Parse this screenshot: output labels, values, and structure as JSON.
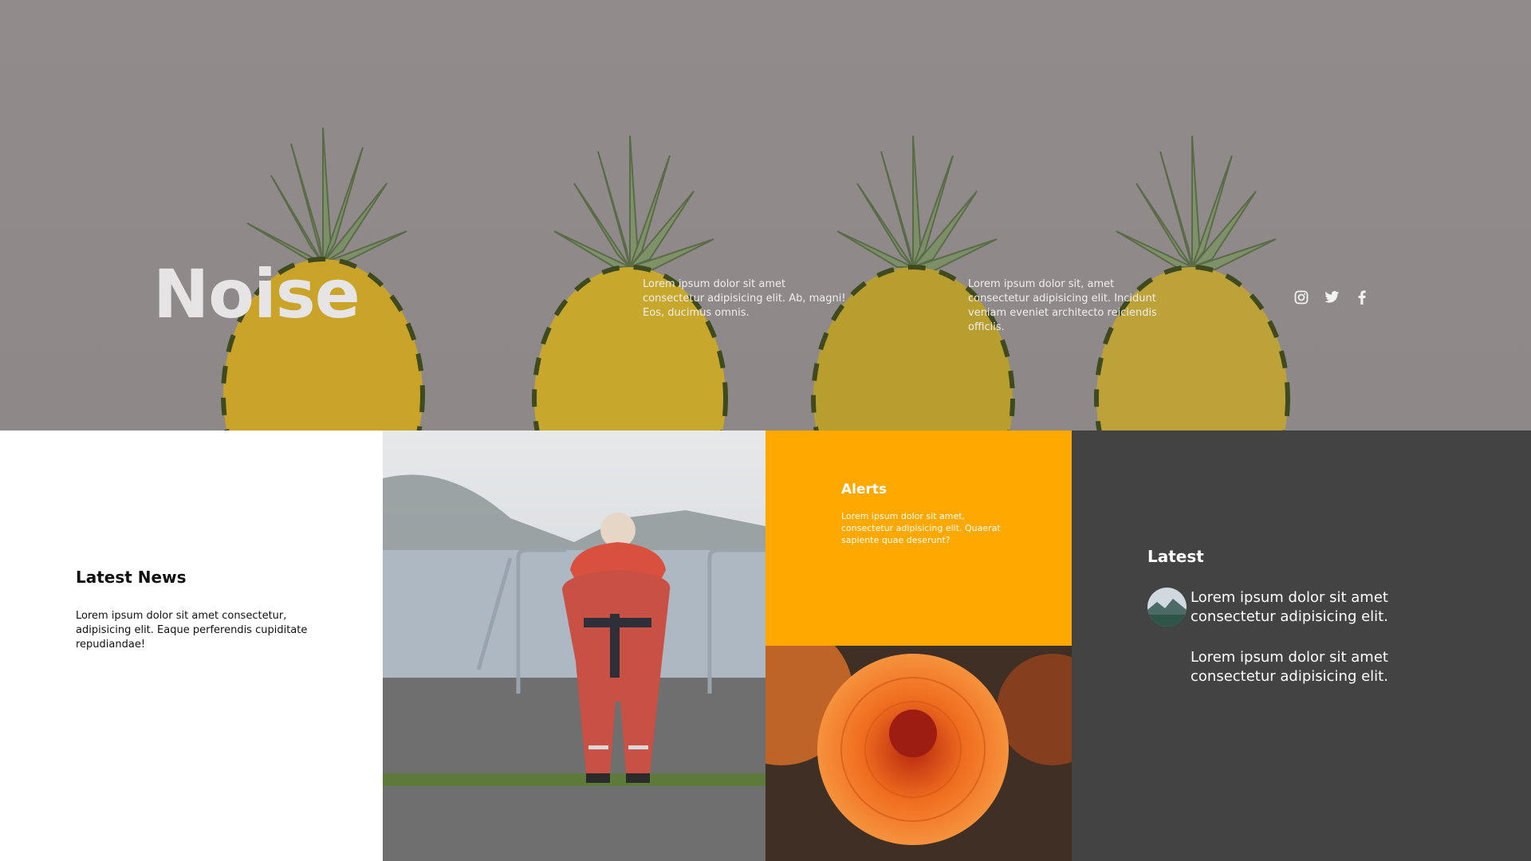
{
  "hero": {
    "title": "Noise",
    "text_left": "Lorem ipsum dolor sit amet consectetur adipisicing elit. Ab, magni! Eos, ducimus omnis.",
    "text_right": "Lorem ipsum dolor sit, amet consectetur adipisicing elit. Incidunt veniam eveniet architecto reiciendis officiis.",
    "social_icons": [
      "instagram-icon",
      "twitter-icon",
      "facebook-icon"
    ]
  },
  "news": {
    "heading": "Latest News",
    "text": "Lorem ipsum dolor sit amet consectetur, adipisicing elit. Eaque perferendis cupiditate repudiandae!"
  },
  "alerts": {
    "heading": "Alerts",
    "text": "Lorem ipsum dolor sit amet, consectetur adipisicing elit. Quaerat sapiente quae deserunt?"
  },
  "latest": {
    "heading": "Latest",
    "items": [
      "Lorem ipsum dolor sit amet consectetur adipisicing elit.",
      "Lorem ipsum dolor sit amet consectetur adipisicing elit."
    ]
  },
  "colors": {
    "hero_bg": "#918b8b",
    "alerts_bg": "#ffa800",
    "latest_bg": "#434343"
  }
}
